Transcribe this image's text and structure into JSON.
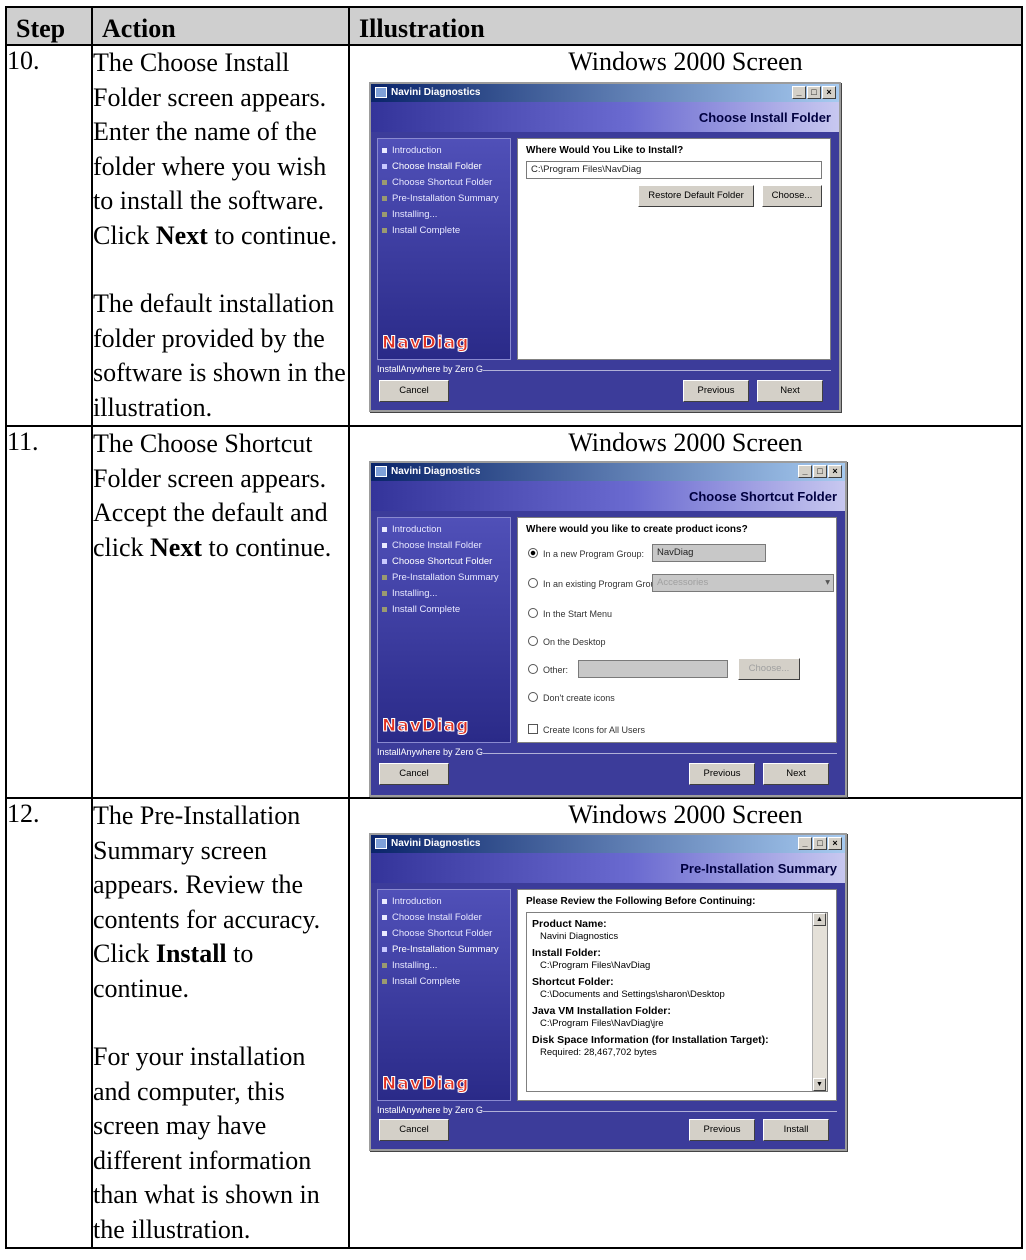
{
  "headers": {
    "step": "Step",
    "action": "Action",
    "illustration": "Illustration"
  },
  "rows": [
    {
      "step": "10.",
      "action_p1_pre": "The Choose Install Folder screen appears. Enter the name of the folder where you wish to install the software. Click ",
      "action_p1_bold": "Next",
      "action_p1_post": " to continue.",
      "action_p2": "The default installation folder provided by the software is shown in the illustration.",
      "caption": "Windows 2000 Screen",
      "window": {
        "title": "Navini Diagnostics",
        "header": "Choose Install Folder",
        "question": "Where Would You Like to Install?",
        "path": "C:\\Program Files\\NavDiag",
        "restore_button": "Restore Default Folder",
        "choose_button": "Choose...",
        "vendor": "InstallAnywhere by Zero G",
        "cancel": "Cancel",
        "previous": "Previous",
        "next": "Next"
      }
    },
    {
      "step": "11.",
      "action_p1_pre": "The Choose Shortcut Folder screen appears. Accept the default and click ",
      "action_p1_bold": "Next",
      "action_p1_post": " to continue.",
      "caption": "Windows 2000 Screen",
      "window": {
        "title": "Navini Diagnostics",
        "header": "Choose Shortcut Folder",
        "question": "Where would you like to create product icons?",
        "opt_new_group": "In a new Program Group:",
        "new_group_value": "NavDiag",
        "opt_existing_group": "In an existing Program Group:",
        "existing_group_value": "Accessories",
        "opt_start_menu": "In the Start Menu",
        "opt_desktop": "On the Desktop",
        "opt_other": "Other:",
        "other_choose": "Choose...",
        "opt_dont_create": "Don't create icons",
        "all_users": "Create Icons for All Users",
        "vendor": "InstallAnywhere by Zero G",
        "cancel": "Cancel",
        "previous": "Previous",
        "next": "Next"
      }
    },
    {
      "step": "12.",
      "action_p1_pre": "The Pre-Installation Summary screen appears. Review the contents for accuracy. Click ",
      "action_p1_bold": "Install",
      "action_p1_post": " to continue.",
      "action_p2": "For your installation and computer, this screen may have different information than what is shown in the illustration.",
      "caption": "Windows 2000 Screen",
      "window": {
        "title": "Navini Diagnostics",
        "header": "Pre-Installation Summary",
        "question": "Please Review the Following Before Continuing:",
        "product_name_label": "Product Name:",
        "product_name_value": "Navini Diagnostics",
        "install_folder_label": "Install Folder:",
        "install_folder_value": "C:\\Program Files\\NavDiag",
        "shortcut_folder_label": "Shortcut Folder:",
        "shortcut_folder_value": "C:\\Documents and Settings\\sharon\\Desktop",
        "java_label": "Java VM Installation Folder:",
        "java_value": "C:\\Program Files\\NavDiag\\jre",
        "disk_label": "Disk Space Information (for Installation Target):",
        "disk_value": "Required: 28,467,702 bytes",
        "vendor": "InstallAnywhere by Zero G",
        "cancel": "Cancel",
        "previous": "Previous",
        "install": "Install"
      }
    }
  ],
  "sidebar_steps": [
    "Introduction",
    "Choose Install Folder",
    "Choose Shortcut Folder",
    "Pre-Installation Summary",
    "Installing...",
    "Install Complete"
  ],
  "logo_text": "NavDiag"
}
